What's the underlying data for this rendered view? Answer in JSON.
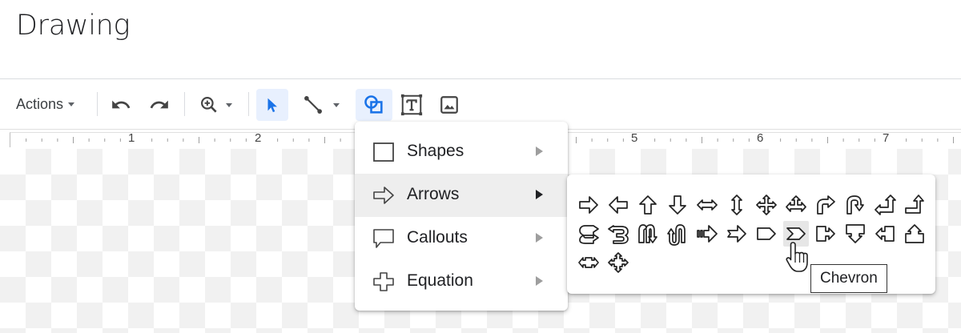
{
  "app": {
    "title": "Drawing"
  },
  "toolbar": {
    "actions_label": "Actions",
    "buttons": [
      {
        "name": "undo",
        "icon": "undo-icon"
      },
      {
        "name": "redo",
        "icon": "redo-icon"
      },
      {
        "name": "zoom",
        "icon": "zoom-icon"
      },
      {
        "name": "select",
        "icon": "cursor-arrow-icon",
        "active": true
      },
      {
        "name": "line",
        "icon": "line-icon"
      },
      {
        "name": "shape",
        "icon": "shape-icon",
        "active": true
      },
      {
        "name": "text-box",
        "icon": "text-box-icon"
      },
      {
        "name": "image",
        "icon": "image-icon"
      }
    ]
  },
  "ruler": {
    "labels": [
      "1",
      "2",
      "5",
      "6",
      "7"
    ]
  },
  "shape_menu": {
    "items": [
      {
        "label": "Shapes",
        "icon": "square-shape-icon"
      },
      {
        "label": "Arrows",
        "icon": "arrow-shape-icon",
        "highlighted": true
      },
      {
        "label": "Callouts",
        "icon": "callout-shape-icon"
      },
      {
        "label": "Equation",
        "icon": "plus-shape-icon"
      }
    ]
  },
  "arrows_submenu": {
    "shapes": [
      "right-arrow",
      "left-arrow",
      "up-arrow",
      "down-arrow",
      "left-right-arrow",
      "up-down-arrow",
      "quad-arrow",
      "left-right-up-arrow",
      "bent-arrow",
      "u-turn-arrow",
      "left-up-arrow",
      "bent-up-arrow",
      "curved-right-arrow",
      "curved-left-arrow",
      "curved-up-arrow",
      "curved-down-arrow",
      "striped-right-arrow",
      "notched-right-arrow",
      "pentagon",
      "chevron",
      "right-arrow-callout",
      "down-arrow-callout",
      "left-arrow-callout",
      "up-arrow-callout",
      "left-right-arrow-callout",
      "quad-arrow-callout"
    ],
    "hovered": "chevron",
    "tooltip": "Chevron"
  },
  "colors": {
    "accent": "#1a73e8",
    "menu_hover": "#eeeeee",
    "active_bg": "#e8f0fe"
  }
}
